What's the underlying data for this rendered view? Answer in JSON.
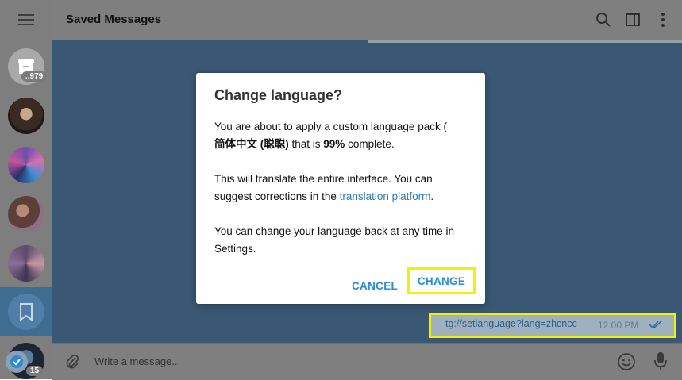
{
  "header": {
    "title": "Saved Messages"
  },
  "sidebar": {
    "archive_badge": "..979",
    "bottom_badge": "15"
  },
  "message": {
    "link": "tg://setlanguage?lang=zhcncc",
    "time": "12:00 PM"
  },
  "composer": {
    "placeholder": "Write a message..."
  },
  "dialog": {
    "title": "Change language?",
    "p1_before": "You are about to apply a custom language pack (",
    "p1_bold_name": "简体中文 (聪聪)",
    "p1_middle": " that is ",
    "p1_bold_pct": "99%",
    "p1_after": " complete.",
    "p2_before": "This will translate the entire interface. You can suggest corrections in the ",
    "p2_link": "translation platform",
    "p2_after": ".",
    "p3": "You can change your language back at any time in Settings.",
    "cancel_label": "CANCEL",
    "change_label": "CHANGE"
  },
  "colors": {
    "accent": "#2e8bd1",
    "highlight": "#f5f000",
    "chat_bg": "#3a5874"
  }
}
